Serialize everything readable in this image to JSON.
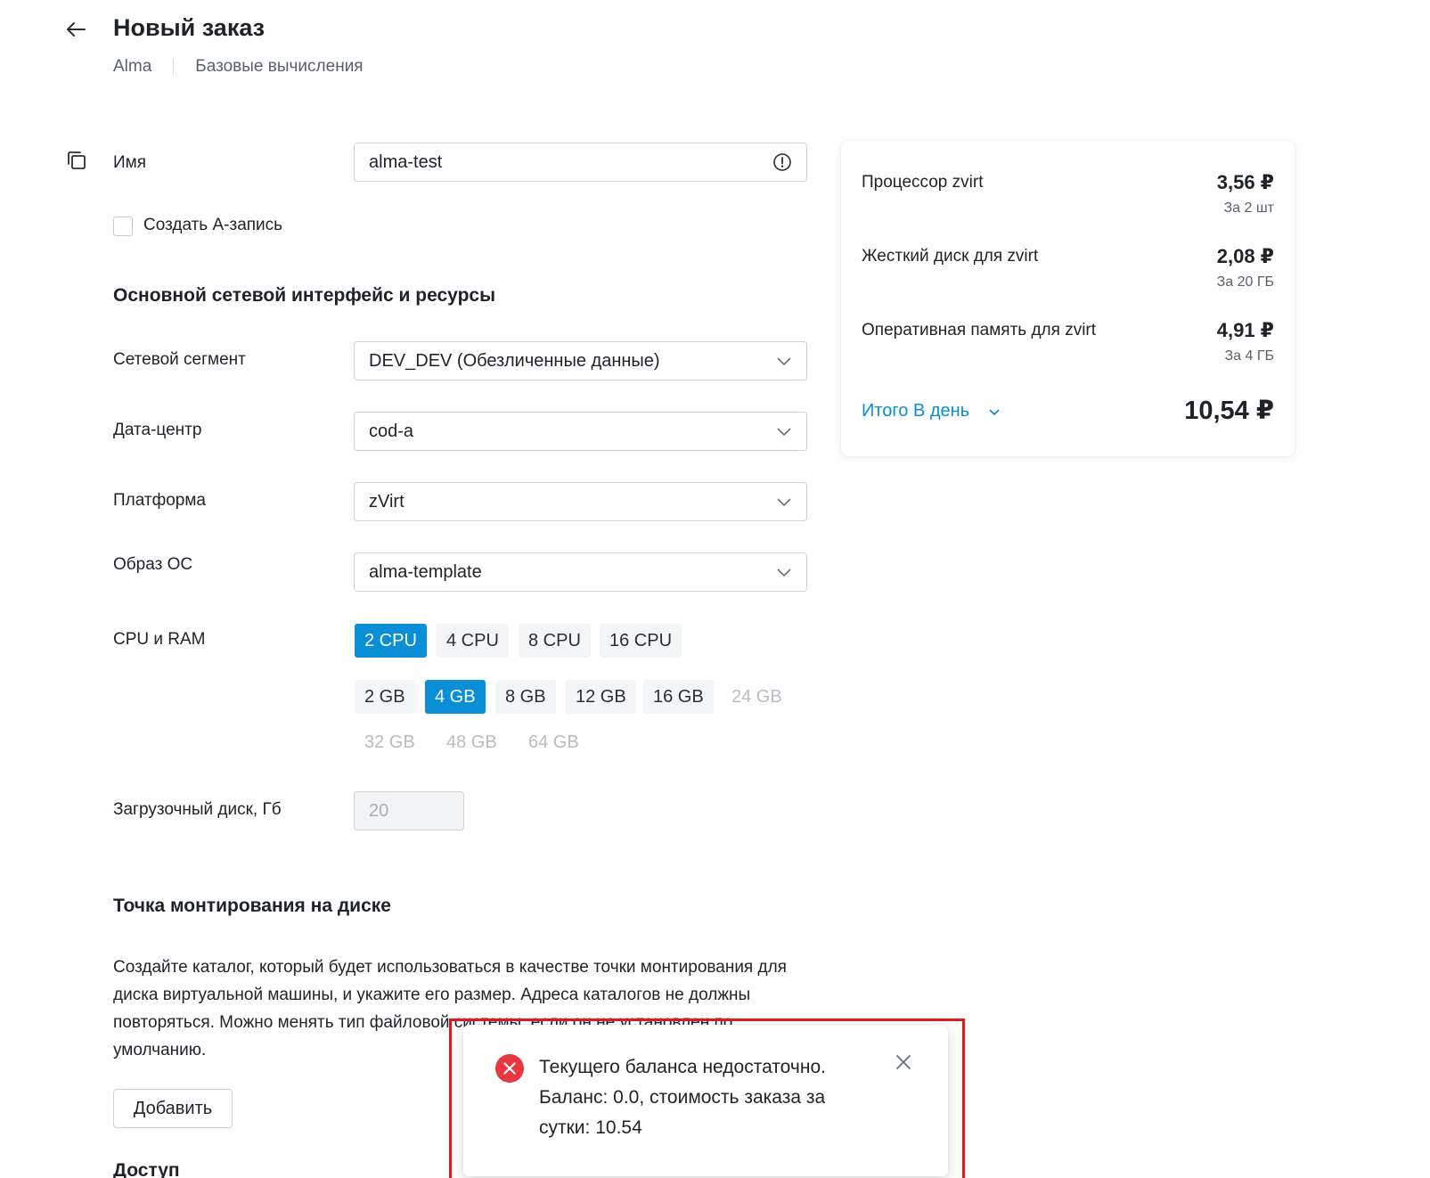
{
  "header": {
    "title": "Новый заказ",
    "breadcrumbs": [
      "Alma",
      "Базовые вычисления"
    ]
  },
  "form": {
    "name_label": "Имя",
    "name_value": "alma-test",
    "create_a_record_label": "Создать А-запись",
    "network_section_title": "Основной сетевой интерфейс и ресурсы",
    "network_segment": {
      "label": "Сетевой сегмент",
      "value": "DEV_DEV (Обезличенные данные)"
    },
    "datacenter": {
      "label": "Дата-центр",
      "value": "cod-a"
    },
    "platform": {
      "label": "Платформа",
      "value": "zVirt"
    },
    "os_image": {
      "label": "Образ ОС",
      "value": "alma-template"
    },
    "cpu_ram_label": "CPU и RAM",
    "cpu_options": [
      {
        "label": "2 CPU",
        "state": "active"
      },
      {
        "label": "4 CPU",
        "state": "normal"
      },
      {
        "label": "8 CPU",
        "state": "normal"
      },
      {
        "label": "16 CPU",
        "state": "normal"
      }
    ],
    "ram_options_row1": [
      {
        "label": "2 GB",
        "state": "normal"
      },
      {
        "label": "4 GB",
        "state": "active"
      },
      {
        "label": "8 GB",
        "state": "normal"
      },
      {
        "label": "12 GB",
        "state": "normal"
      },
      {
        "label": "16 GB",
        "state": "normal"
      },
      {
        "label": "24 GB",
        "state": "disabled"
      }
    ],
    "ram_options_row2": [
      {
        "label": "32 GB",
        "state": "disabled"
      },
      {
        "label": "48 GB",
        "state": "disabled"
      },
      {
        "label": "64 GB",
        "state": "disabled"
      }
    ],
    "boot_disk": {
      "label": "Загрузочный диск, Гб",
      "value": "20"
    },
    "mount_section_title": "Точка монтирования на диске",
    "mount_description": "Создайте каталог, который будет использоваться в качестве точки монтирования для диска виртуальной машины, и укажите его размер. Адреса каталогов не должны повторяться. Можно менять тип файловой системы, если он не установлен по умолчанию.",
    "add_button": "Добавить",
    "access_section_title": "Доступ"
  },
  "summary": {
    "items": [
      {
        "name": "Процессор zvirt",
        "price": "3,56 ₽",
        "qty": "За 2 шт"
      },
      {
        "name": "Жесткий диск для zvirt",
        "price": "2,08 ₽",
        "qty": "За 20 ГБ"
      },
      {
        "name": "Оперативная память для zvirt",
        "price": "4,91 ₽",
        "qty": "За 4 ГБ"
      }
    ],
    "total_label": "Итого В день",
    "total_value": "10,54 ₽"
  },
  "toast": {
    "message": "Текущего баланса недостаточно. Баланс: 0.0, стоимость заказа за сутки: 10.54"
  },
  "colors": {
    "accent": "#0a8fd6",
    "error": "#e8373e",
    "highlight_outline": "#e0191f"
  }
}
